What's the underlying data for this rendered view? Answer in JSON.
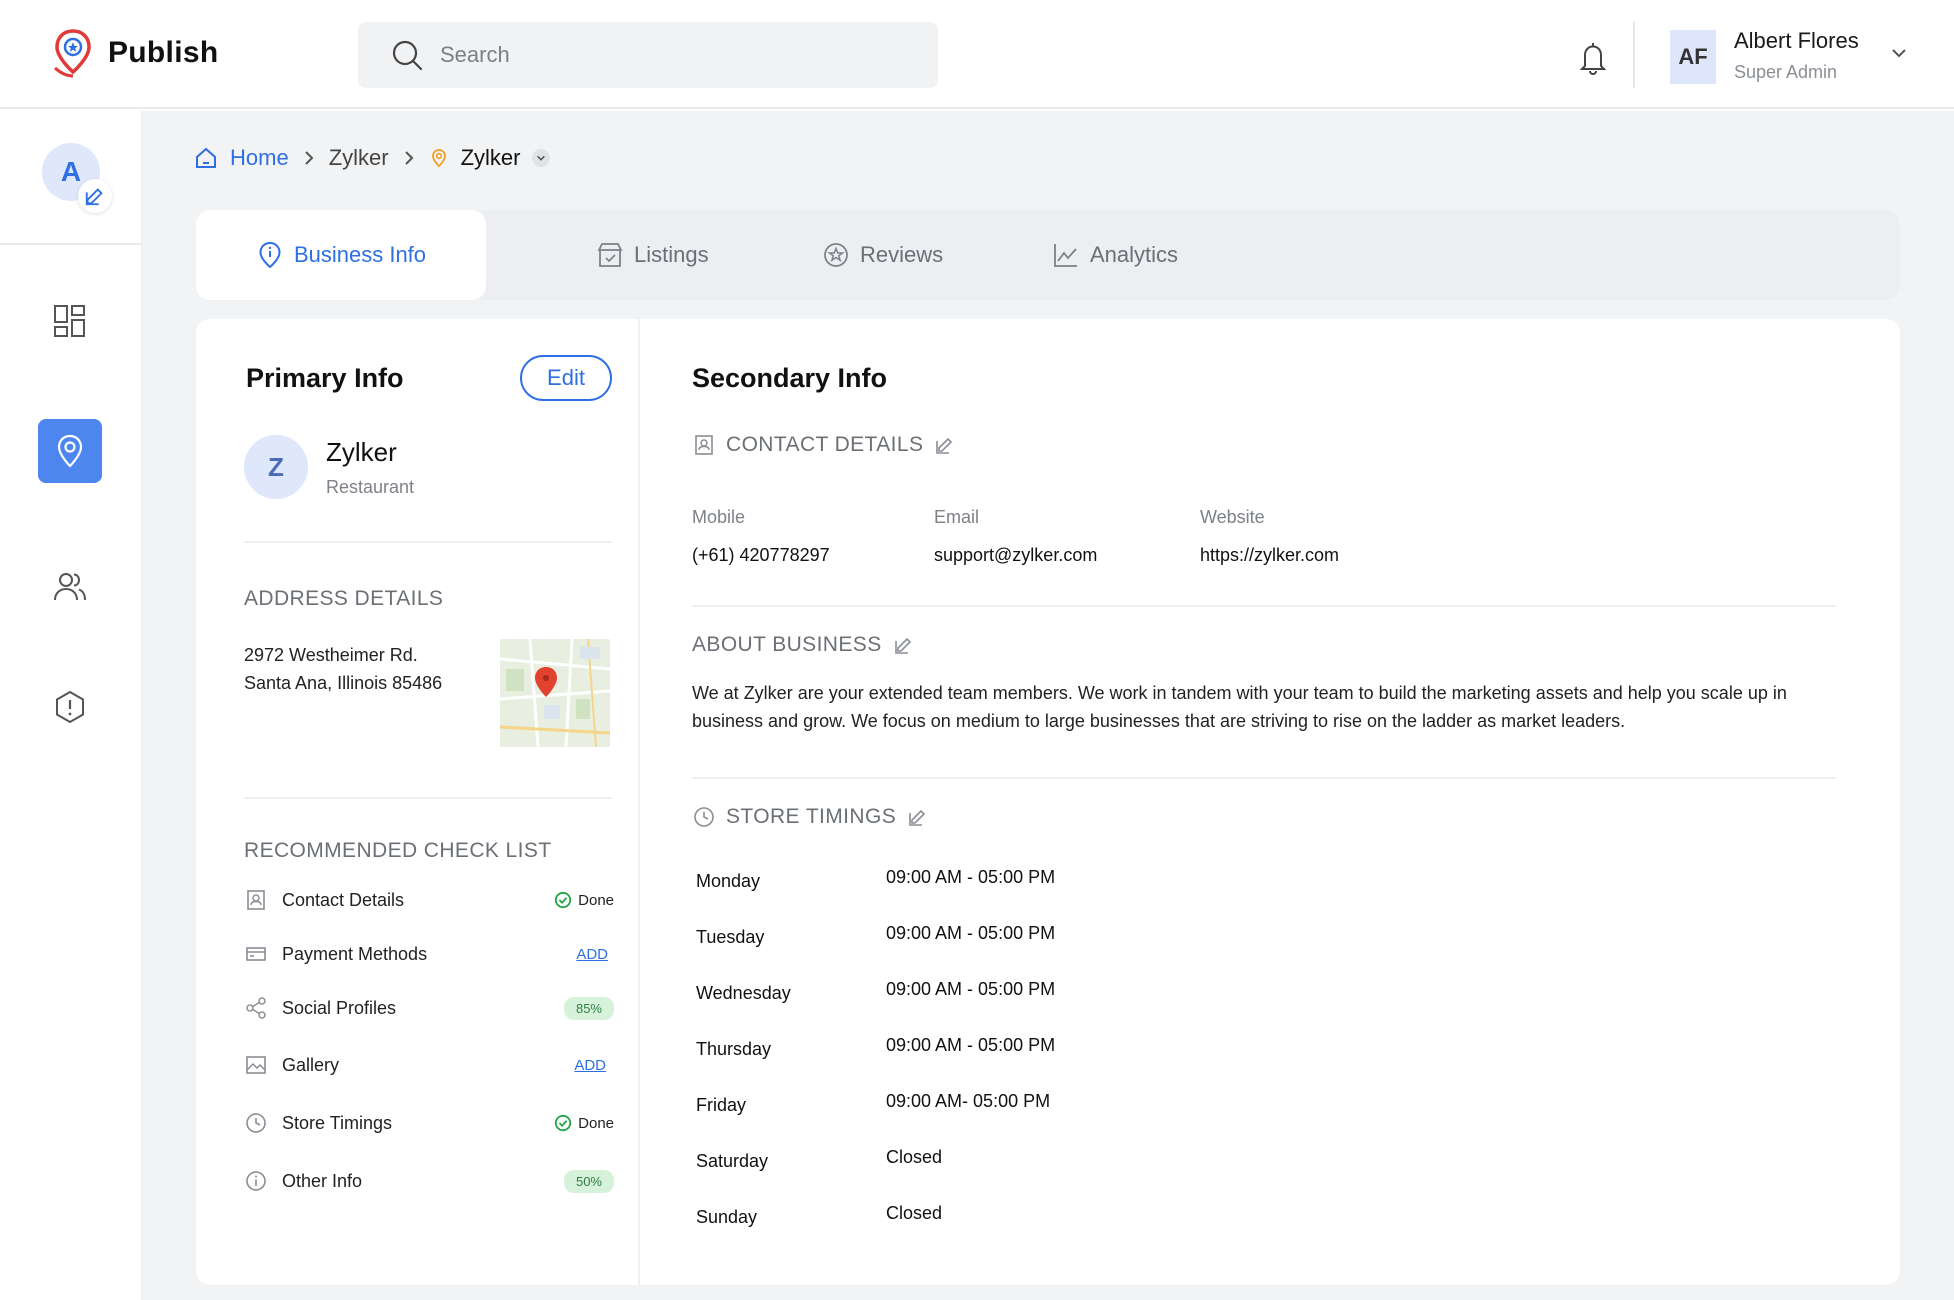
{
  "app": {
    "name": "Publish"
  },
  "search": {
    "placeholder": "Search"
  },
  "user": {
    "initials": "AF",
    "name": "Albert Flores",
    "role": "Super Admin"
  },
  "sidebar": {
    "avatar_letter": "A"
  },
  "breadcrumb": {
    "home": "Home",
    "level1": "Zylker",
    "current": "Zylker"
  },
  "tabs": [
    {
      "label": "Business Info",
      "icon": "info-pin-icon",
      "active": true
    },
    {
      "label": "Listings",
      "icon": "store-icon",
      "active": false
    },
    {
      "label": "Reviews",
      "icon": "star-icon",
      "active": false
    },
    {
      "label": "Analytics",
      "icon": "chart-icon",
      "active": false
    }
  ],
  "primary": {
    "title": "Primary Info",
    "edit_label": "Edit",
    "business_initial": "Z",
    "business_name": "Zylker",
    "business_type": "Restaurant",
    "address_title": "ADDRESS DETAILS",
    "address_line1": "2972 Westheimer Rd.",
    "address_line2": "Santa Ana, Illinois 85486",
    "checklist_title": "RECOMMENDED CHECK LIST",
    "checklist": [
      {
        "label": "Contact Details",
        "status": "Done",
        "kind": "done"
      },
      {
        "label": "Payment Methods",
        "status": "ADD",
        "kind": "add"
      },
      {
        "label": "Social Profiles",
        "status": "85%",
        "kind": "pct"
      },
      {
        "label": "Gallery",
        "status": "ADD",
        "kind": "add"
      },
      {
        "label": "Store Timings",
        "status": "Done",
        "kind": "done"
      },
      {
        "label": "Other Info",
        "status": "50%",
        "kind": "pct"
      }
    ]
  },
  "secondary": {
    "title": "Secondary Info",
    "contact_title": "CONTACT DETAILS",
    "mobile_label": "Mobile",
    "mobile_value": "(+61) 420778297",
    "email_label": "Email",
    "email_value": "support@zylker.com",
    "website_label": "Website",
    "website_value": "https://zylker.com",
    "about_title": "ABOUT BUSINESS",
    "about_text": "We at Zylker are your extended team members. We work in tandem with your team to build the marketing assets and help you scale up in business and grow. We focus on medium to large businesses that are striving to rise on the ladder as market leaders.",
    "timings_title": "STORE TIMINGS",
    "timings": [
      {
        "day": "Monday",
        "hours": "09:00 AM - 05:00 PM"
      },
      {
        "day": "Tuesday",
        "hours": "09:00 AM - 05:00 PM"
      },
      {
        "day": "Wednesday",
        "hours": "09:00 AM - 05:00 PM"
      },
      {
        "day": "Thursday",
        "hours": "09:00 AM - 05:00 PM"
      },
      {
        "day": "Friday",
        "hours": "09:00 AM- 05:00 PM"
      },
      {
        "day": "Saturday",
        "hours": "Closed"
      },
      {
        "day": "Sunday",
        "hours": "Closed"
      }
    ]
  },
  "colors": {
    "accent": "#2f6fe4",
    "active_nav": "#4d86ef",
    "done_green": "#1fa64a",
    "pct_bg": "#d6f2da"
  }
}
